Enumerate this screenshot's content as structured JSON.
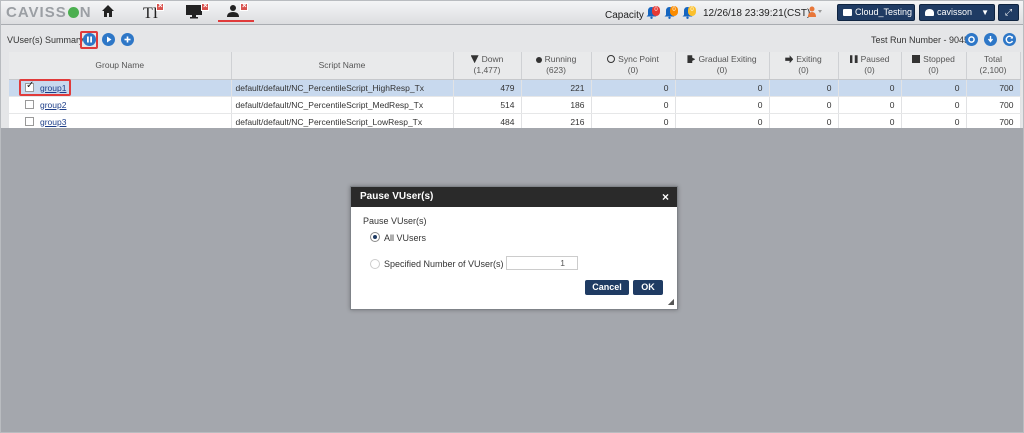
{
  "app": {
    "logo": "CAVISS",
    "logo_suffix": "N"
  },
  "topbar": {
    "capacity_label": "Capacity",
    "bell_counts": [
      "0",
      "0",
      "0"
    ],
    "datetime": "12/26/18 23:39:21(CST)",
    "project_button": "Cloud_Testing",
    "user_button": "cavisson"
  },
  "summary": {
    "title": "VUser(s) Summary",
    "test_run": "Test Run Number - 9045"
  },
  "table": {
    "headers": {
      "group": "Group Name",
      "script": "Script Name",
      "down": "Down",
      "down_sub": "(1,477)",
      "running": "Running",
      "running_sub": "(623)",
      "sync": "Sync Point",
      "sync_sub": "(0)",
      "gradual": "Gradual Exiting",
      "gradual_sub": "(0)",
      "exiting": "Exiting",
      "exiting_sub": "(0)",
      "paused": "Paused",
      "paused_sub": "(0)",
      "stopped": "Stopped",
      "stopped_sub": "(0)",
      "total": "Total",
      "total_sub": "(2,100)"
    },
    "rows": [
      {
        "group": "group1",
        "script": "default/default/NC_PercentileScript_HighResp_Tx",
        "down": "479",
        "running": "221",
        "sync": "0",
        "gradual": "0",
        "exiting": "0",
        "paused": "0",
        "stopped": "0",
        "total": "700"
      },
      {
        "group": "group2",
        "script": "default/default/NC_PercentileScript_MedResp_Tx",
        "down": "514",
        "running": "186",
        "sync": "0",
        "gradual": "0",
        "exiting": "0",
        "paused": "0",
        "stopped": "0",
        "total": "700"
      },
      {
        "group": "group3",
        "script": "default/default/NC_PercentileScript_LowResp_Tx",
        "down": "484",
        "running": "216",
        "sync": "0",
        "gradual": "0",
        "exiting": "0",
        "paused": "0",
        "stopped": "0",
        "total": "700"
      }
    ]
  },
  "dialog": {
    "title": "Pause VUser(s)",
    "close": "×",
    "section_label": "Pause VUser(s)",
    "option_all": "All VUsers",
    "option_specified": "Specified Number of VUser(s)",
    "number_value": "1",
    "cancel": "Cancel",
    "ok": "OK"
  },
  "colors": {
    "accent": "#1f3b63",
    "highlight": "#e03b3b",
    "selected_row": "#c8d9ee"
  }
}
